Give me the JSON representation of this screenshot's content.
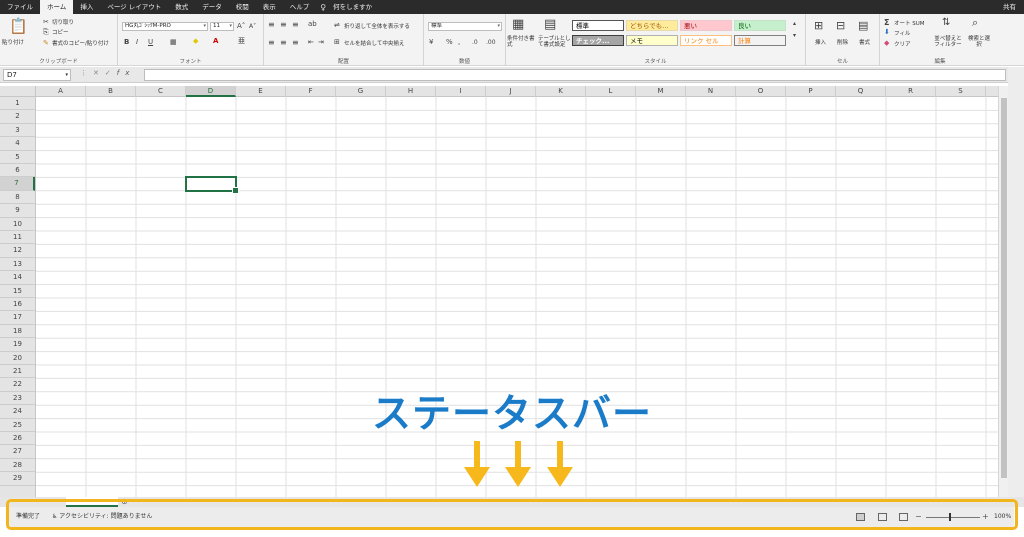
{
  "menu": {
    "tabs": [
      "ファイル",
      "ホーム",
      "挿入",
      "ページ レイアウト",
      "数式",
      "データ",
      "校閲",
      "表示",
      "ヘルプ"
    ],
    "active_tab": "ホーム",
    "search_placeholder": "何をしますか",
    "share": "共有"
  },
  "ribbon": {
    "clipboard": {
      "paste": "貼り付け",
      "cut": "切り取り",
      "copy": "コピー",
      "format_painter": "書式のコピー/貼り付け",
      "label": "クリップボード"
    },
    "font": {
      "name": "HG丸ｺﾞｼｯｸM-PRO",
      "size": "11",
      "label": "フォント"
    },
    "alignment": {
      "wrap": "折り返して全体を表示する",
      "merge": "セルを結合して中央揃え",
      "label": "配置"
    },
    "number": {
      "format": "標準",
      "label": "数値"
    },
    "styles": {
      "conditional": "条件付き書式",
      "table": "テーブルとして書式設定",
      "cells": [
        "標準",
        "どちらでも...",
        "悪い",
        "良い",
        "チェック...",
        "メモ",
        "リンク セル",
        "計算"
      ],
      "label": "スタイル"
    },
    "cells_group": {
      "insert": "挿入",
      "delete": "削除",
      "format": "書式",
      "label": "セル"
    },
    "editing": {
      "autosum": "オート SUM",
      "fill": "フィル",
      "clear": "クリア",
      "sort": "並べ替えとフィルター",
      "find": "検索と選択",
      "label": "編集"
    }
  },
  "formula_bar": {
    "name_box": "D7",
    "fx": "fx",
    "value": ""
  },
  "grid": {
    "columns": [
      "A",
      "B",
      "C",
      "D",
      "E",
      "F",
      "G",
      "H",
      "I",
      "J",
      "K",
      "L",
      "M",
      "N",
      "O",
      "P",
      "Q",
      "R",
      "S"
    ],
    "rows": [
      "1",
      "2",
      "3",
      "4",
      "5",
      "6",
      "7",
      "8",
      "9",
      "10",
      "11",
      "12",
      "13",
      "14",
      "15",
      "16",
      "17",
      "18",
      "19",
      "20",
      "21",
      "22",
      "23",
      "24",
      "25",
      "26",
      "27",
      "28",
      "29"
    ],
    "active_column": "D",
    "active_row": "7"
  },
  "status_bar": {
    "ready": "準備完了",
    "accessibility": "アクセシビリティ: 問題ありません",
    "zoom": "100%"
  },
  "annotation": {
    "text": "ステータスバー",
    "color": "#1a7bc9",
    "arrow_color": "#f7b81b",
    "highlight_color": "#f3b51c"
  }
}
